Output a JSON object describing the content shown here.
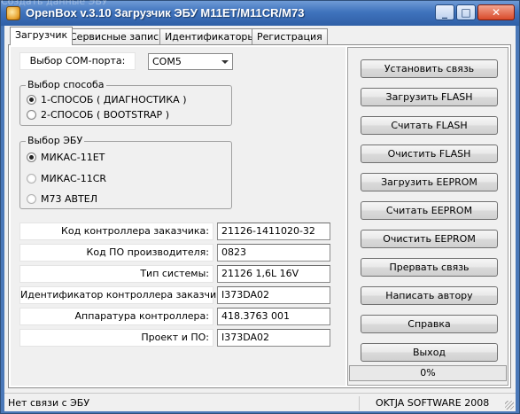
{
  "window": {
    "title": "OpenBox v.3.10 Загрузчик ЭБУ M11ET/M11CR/M73",
    "ghost_text": "Создать данные ЭБУ",
    "minimize_glyph": "_",
    "maximize_glyph": "□",
    "close_glyph": "✕"
  },
  "tabs": [
    {
      "label": "Загрузчик",
      "active": true
    },
    {
      "label": "Сервисные записи",
      "active": false
    },
    {
      "label": "Идентификаторы",
      "active": false
    },
    {
      "label": "Регистрация",
      "active": false
    }
  ],
  "com_port": {
    "label": "Выбор COM-порта:",
    "selected": "COM5"
  },
  "method_group": {
    "title": "Выбор способа",
    "options": [
      {
        "label": "1-СПОСОБ ( ДИАГНОСТИКА )",
        "checked": true
      },
      {
        "label": "2-СПОСОБ ( BOOTSTRAP )",
        "checked": false
      }
    ]
  },
  "ecu_group": {
    "title": "Выбор ЭБУ",
    "options": [
      {
        "label": "МИКАС-11ЕТ",
        "checked": true
      },
      {
        "label": "МИКАС-11CR",
        "checked": false
      },
      {
        "label": "M73 АВТЕЛ",
        "checked": false
      }
    ]
  },
  "info_fields": [
    {
      "label": "Код контроллера заказчика:",
      "value": "21126-1411020-32"
    },
    {
      "label": "Код ПО производителя:",
      "value": "0823"
    },
    {
      "label": "Тип системы:",
      "value": "21126 1,6L 16V"
    },
    {
      "label": "Идентификатор контроллера заказчика:",
      "value": "I373DA02"
    },
    {
      "label": "Аппаратура контроллера:",
      "value": "418.3763 001"
    },
    {
      "label": "Проект и ПО:",
      "value": "I373DA02"
    }
  ],
  "buttons": [
    "Установить связь",
    "Загрузить FLASH",
    "Считать FLASH",
    "Очистить FLASH",
    "Загрузить EEPROM",
    "Считать EEPROM",
    "Очистить EEPROM",
    "Прервать связь",
    "Написать автору",
    "Справка",
    "Выход"
  ],
  "progress": {
    "text": "0%",
    "value": 0
  },
  "status": {
    "left": "Нет связи с ЭБУ",
    "right": "OKTJA SOFTWARE 2008"
  },
  "colors": {
    "title_bar": "#3f73bd",
    "close_button": "#d84a2a",
    "panel_bg": "#f0f0f0"
  }
}
